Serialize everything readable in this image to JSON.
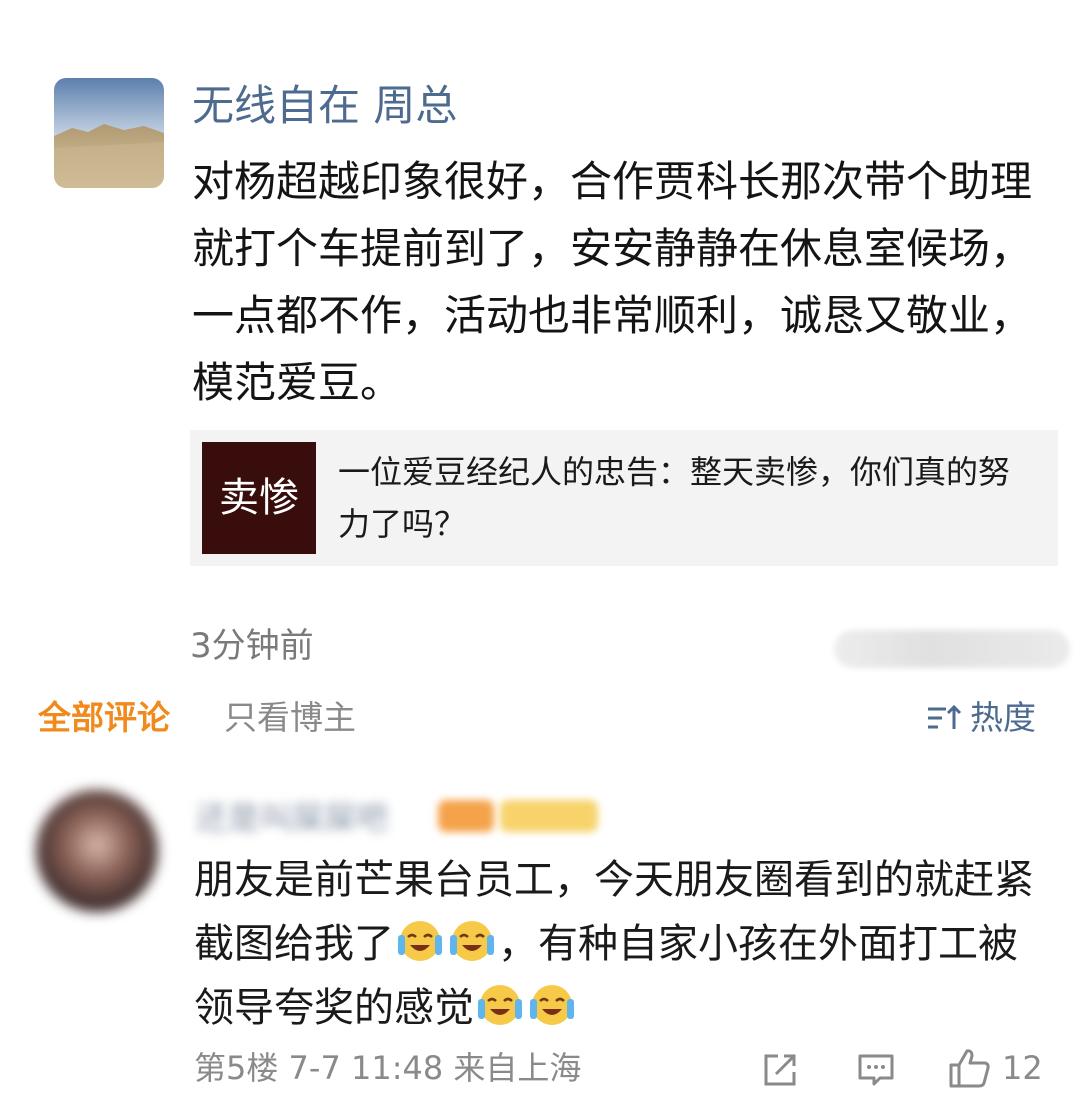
{
  "post": {
    "author": "无线自在 周总",
    "text": "对杨超越印象很好，合作贾科长那次带个助理就打个车提前到了，安安静静在休息室候场，一点都不作，活动也非常顺利，诚恳又敬业，模范爱豆。",
    "link_card": {
      "thumb_text": "卖惨",
      "title": "一位爱豆经纪人的忠告：整天卖惨，你们真的努力了吗？"
    },
    "time": "3分钟前"
  },
  "tabs": {
    "all": "全部评论",
    "author_only": "只看博主",
    "sort": "热度"
  },
  "comment": {
    "username": "还是叫屎屎吧",
    "text_part1": "朋友是前芒果台员工，今天朋友圈看到的就赶紧截图给我了",
    "text_part2": "，有种自家小孩在外面打工被领导夸奖的感觉",
    "meta": "第5楼 7-7 11:48 来自上海",
    "like_count": "12",
    "emoji_name": "crying-laughing-emoji"
  },
  "colors": {
    "author_blue": "#4d6a8f",
    "tab_active_orange": "#f08a1c",
    "meta_gray": "#8a8a8a"
  }
}
